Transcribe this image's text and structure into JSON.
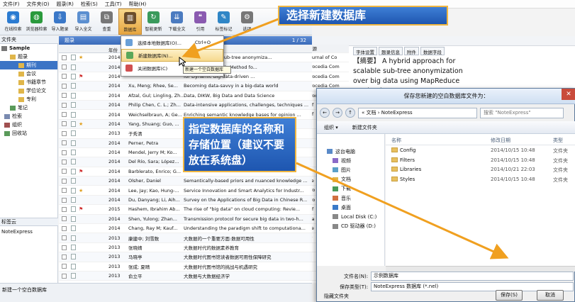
{
  "menubar": [
    "文件(F)",
    "文件夹(O)",
    "题录(R)",
    "检索(S)",
    "工具(T)",
    "帮助(H)"
  ],
  "toolbar": [
    {
      "label": "在线检索",
      "color": "#2b7bd1",
      "icon": "globe-icon",
      "glyph": "◉"
    },
    {
      "label": "浏览器检索",
      "color": "#2a9a3c",
      "icon": "browser-icon",
      "glyph": "◍"
    },
    {
      "label": "导入题录",
      "color": "#3a78c8",
      "icon": "import-icon",
      "glyph": "⇩"
    },
    {
      "label": "导入全文",
      "color": "#5b8fd0",
      "icon": "fulltext-icon",
      "glyph": "▤"
    },
    {
      "label": "查重",
      "color": "#777",
      "icon": "duplicate-icon",
      "glyph": "⧉"
    },
    {
      "label": "数据库",
      "color": "#6b4d2b",
      "icon": "database-icon",
      "glyph": "▥"
    },
    {
      "label": "智能更新",
      "color": "#3a9a5c",
      "icon": "update-icon",
      "glyph": "↻"
    },
    {
      "label": "下载全文",
      "color": "#4b7bc0",
      "icon": "download-icon",
      "glyph": "⇊"
    },
    {
      "label": "引用",
      "color": "#8a5ab0",
      "icon": "cite-icon",
      "glyph": "❝"
    },
    {
      "label": "标签标记",
      "color": "#2f86c6",
      "icon": "tag-icon",
      "glyph": "✎"
    },
    {
      "label": "选项",
      "color": "#777",
      "icon": "options-icon",
      "glyph": "⚙"
    }
  ],
  "tree": {
    "title": "文件夹",
    "nodes": [
      {
        "label": "Sample",
        "indent": 2,
        "color": "#777",
        "selected": false,
        "bold": true
      },
      {
        "label": "题录",
        "indent": 14,
        "color": "#e0b64a",
        "selected": false
      },
      {
        "label": "期刊",
        "indent": 26,
        "color": "#e0b64a",
        "selected": true
      },
      {
        "label": "会议",
        "indent": 26,
        "color": "#e0b64a",
        "selected": false
      },
      {
        "label": "书籍章节",
        "indent": 26,
        "color": "#e0b64a",
        "selected": false
      },
      {
        "label": "学位论文",
        "indent": 26,
        "color": "#e0b64a",
        "selected": false
      },
      {
        "label": "专利",
        "indent": 26,
        "color": "#e0b64a",
        "selected": false
      },
      {
        "label": "笔记",
        "indent": 14,
        "color": "#5a9a5a",
        "selected": false
      },
      {
        "label": "检索",
        "indent": 6,
        "color": "#7a8ab0",
        "selected": false
      },
      {
        "label": "组织",
        "indent": 6,
        "color": "#a05050",
        "selected": false
      },
      {
        "label": "回收站",
        "indent": 6,
        "color": "#5a9a5a",
        "selected": false
      }
    ],
    "sep_label": "标签云",
    "ne_label": "NoteExpress"
  },
  "status": "新建一个空白数据库",
  "list": {
    "header": "题录",
    "count": "1 / 32",
    "columns": [
      "年份",
      "作者",
      "标题",
      "来源"
    ],
    "rows": [
      {
        "year": "2014",
        "author": "",
        "title": "ach for scalable sub-tree anonymiza...",
        "source": "Journal of Co",
        "flag": "",
        "star": true
      },
      {
        "year": "2014",
        "author": "",
        "title": "g Big Data Analysis Method fo...",
        "source": "Procedia Com",
        "flag": "",
        "star": false
      },
      {
        "year": "2014",
        "author": "",
        "title": "for Dynamic Big-data-driven ...",
        "source": "Procedia Com",
        "flag": "red",
        "star": false
      },
      {
        "year": "2014",
        "author": "Xu, Meng; Rhee, Se...",
        "title": "Becoming data-savvy in a big-data world",
        "source": "Procedia Com",
        "flag": "",
        "star": false
      },
      {
        "year": "2014",
        "author": "Afzal, Gul; Lingling, Zh...",
        "title": "Data, DIKW, Big Data and Data Science",
        "source": "Procedia Com",
        "flag": "",
        "star": false
      },
      {
        "year": "2014",
        "author": "Philip Chen, C. L.; Zh...",
        "title": "Data-intensive applications, challenges, techniques ...",
        "source": "Inf",
        "flag": "",
        "star": false
      },
      {
        "year": "2014",
        "author": "Weichselbraun, A; Ge...",
        "title": "Enriching semantic knowledge bases for opinion ...",
        "source": "Inf",
        "flag": "",
        "star": false
      },
      {
        "year": "2014",
        "author": "Yang, Shuang; Guo, ...",
        "title": "",
        "source": "",
        "flag": "",
        "star": true
      },
      {
        "year": "2013",
        "author": "于秀清",
        "title": "",
        "source": "",
        "flag": "",
        "star": false
      },
      {
        "year": "2014",
        "author": "Perner, Petra",
        "title": "",
        "source": "",
        "flag": "",
        "star": false
      },
      {
        "year": "2014",
        "author": "Mendel, Jerry M; Ko...",
        "title": "",
        "source": "",
        "flag": "",
        "star": false
      },
      {
        "year": "2014",
        "author": "Del Río, Sara; López...",
        "title": "",
        "source": "",
        "flag": "",
        "star": false
      },
      {
        "year": "2014",
        "author": "Barblerato, Enrico; G...",
        "title": "",
        "source": "",
        "flag": "red",
        "star": false
      },
      {
        "year": "2014",
        "author": "Olsher, Daniel",
        "title": "Semantically-based priors and nuanced knowledge ...",
        "source": "Ne",
        "flag": "",
        "star": false
      },
      {
        "year": "2014",
        "author": "Lee, Jay; Kao, Hung-...",
        "title": "Service Innovation and Smart Analytics for Industr...",
        "source": "Pro",
        "flag": "",
        "star": true
      },
      {
        "year": "2014",
        "author": "Du, Danyang; Li, Aih...",
        "title": "Survey on the Applications of Big Data in Chinese R...",
        "source": "Pro",
        "flag": "",
        "star": false
      },
      {
        "year": "2015",
        "author": "Hashem, Ibrahim Ab...",
        "title": "The rise of \"big data\" on cloud computing: Revie...",
        "source": "Inf",
        "flag": "red",
        "star": false
      },
      {
        "year": "2014",
        "author": "Shen, Yulong; Zhan...",
        "title": "Transmission protocol for secure big data in two-h...",
        "source": "Ma",
        "flag": "",
        "star": false
      },
      {
        "year": "2014",
        "author": "Chang, Ray M; Kauf...",
        "title": "Understanding the paradigm shift to computationa...",
        "source": "De",
        "flag": "",
        "star": false
      },
      {
        "year": "2013",
        "author": "康建中; 刘雪数",
        "title": "大数据的一个重要方面:数据可用性",
        "source": "计",
        "flag": "",
        "star": false
      },
      {
        "year": "2013",
        "author": "张晓婧",
        "title": "大数据时代的数据素养教育",
        "source": "图",
        "flag": "",
        "star": false
      },
      {
        "year": "2013",
        "author": "马晓亭",
        "title": "大数据时代图书馆读者数据可用性保障研究",
        "source": "图",
        "flag": "",
        "star": false
      },
      {
        "year": "2013",
        "author": "张成; 夏晴",
        "title": "大数据时代图书馆的挑战与机遇研究",
        "source": "图",
        "flag": "",
        "star": false
      },
      {
        "year": "2013",
        "author": "俞立平",
        "title": "大数据与大数据经济学",
        "source": "中",
        "flag": "",
        "star": false
      }
    ]
  },
  "preview": {
    "tabs": [
      "字体设置",
      "题录信息",
      "附件",
      "数据字段"
    ],
    "abstract": "【摘要】 A hybrid approach for scalable sub-tree anonymization over big data using MapReduce on cloud"
  },
  "dropdown": {
    "items": [
      {
        "label": "选择本地数据库(O)...",
        "shortcut": "Ctrl+O",
        "color": "#6aa0d8",
        "highlight": false
      },
      {
        "label": "新建数据库(N)...",
        "shortcut": "",
        "color": "#5aa75a",
        "highlight": true
      },
      {
        "label": "关闭数据库(C)",
        "shortcut": "",
        "color": "#d05050",
        "highlight": false
      }
    ],
    "tooltip": "新建一个空白数据库"
  },
  "callouts": {
    "top": "选择新建数据库",
    "middle": "指定数据库的名称和存储位置（建议不要放在系统盘）"
  },
  "dialog": {
    "title": "保存您新建的空白数据库文件为：",
    "path": "« 文档 › NoteExpress",
    "search_placeholder": "搜索 \"NoteExpress\"",
    "commands": [
      "组织 ▾",
      "新建文件夹"
    ],
    "nav": [
      {
        "label": "这台电脑",
        "color": "#5a8ac8"
      },
      {
        "label": "视频",
        "color": "#8a6ac8"
      },
      {
        "label": "图片",
        "color": "#5aa0c8"
      },
      {
        "label": "文档",
        "color": "#e0b64a"
      },
      {
        "label": "下载",
        "color": "#4a9a5a"
      },
      {
        "label": "音乐",
        "color": "#d07040"
      },
      {
        "label": "桌面",
        "color": "#3a7ac8"
      },
      {
        "label": "Local Disk (C:)",
        "color": "#888"
      },
      {
        "label": "CD 驱动器 (D:)",
        "color": "#888"
      }
    ],
    "columns": [
      "名称",
      "修改日期",
      "类型"
    ],
    "files": [
      {
        "name": "Config",
        "date": "2014/10/15 10:48",
        "type": "文件夹"
      },
      {
        "name": "Filters",
        "date": "2014/10/15 10:48",
        "type": "文件夹"
      },
      {
        "name": "Libraries",
        "date": "2014/10/21 22:03",
        "type": "文件夹"
      },
      {
        "name": "Styles",
        "date": "2014/10/15 10:48",
        "type": "文件夹"
      }
    ],
    "filename_label": "文件名(N):",
    "filename_value": "示例数据库",
    "filetype_label": "保存类型(T):",
    "filetype_value": "NoteExpress 数据库 (*.nel)",
    "hide_folders": "隐藏文件夹",
    "save_label": "保存(S)",
    "cancel_label": "取消"
  },
  "colors": {
    "accent": "#3a6ab8",
    "callout": "#2a62bd",
    "callout_border": "#f0b640",
    "selected": "#3b74c5"
  }
}
